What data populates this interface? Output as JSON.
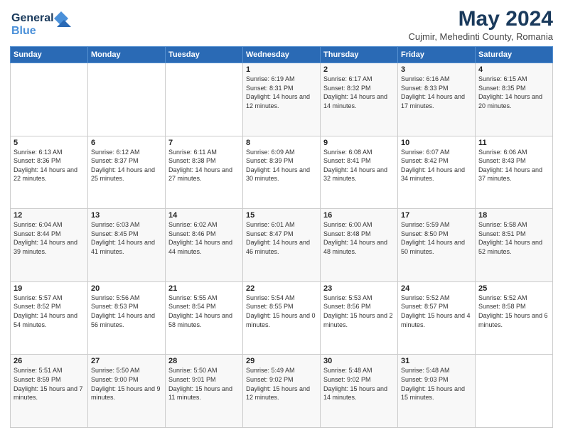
{
  "logo": {
    "line1": "General",
    "line2": "Blue"
  },
  "title": "May 2024",
  "subtitle": "Cujmir, Mehedinti County, Romania",
  "weekdays": [
    "Sunday",
    "Monday",
    "Tuesday",
    "Wednesday",
    "Thursday",
    "Friday",
    "Saturday"
  ],
  "weeks": [
    [
      {
        "day": "",
        "sunrise": "",
        "sunset": "",
        "daylight": ""
      },
      {
        "day": "",
        "sunrise": "",
        "sunset": "",
        "daylight": ""
      },
      {
        "day": "",
        "sunrise": "",
        "sunset": "",
        "daylight": ""
      },
      {
        "day": "1",
        "sunrise": "Sunrise: 6:19 AM",
        "sunset": "Sunset: 8:31 PM",
        "daylight": "Daylight: 14 hours and 12 minutes."
      },
      {
        "day": "2",
        "sunrise": "Sunrise: 6:17 AM",
        "sunset": "Sunset: 8:32 PM",
        "daylight": "Daylight: 14 hours and 14 minutes."
      },
      {
        "day": "3",
        "sunrise": "Sunrise: 6:16 AM",
        "sunset": "Sunset: 8:33 PM",
        "daylight": "Daylight: 14 hours and 17 minutes."
      },
      {
        "day": "4",
        "sunrise": "Sunrise: 6:15 AM",
        "sunset": "Sunset: 8:35 PM",
        "daylight": "Daylight: 14 hours and 20 minutes."
      }
    ],
    [
      {
        "day": "5",
        "sunrise": "Sunrise: 6:13 AM",
        "sunset": "Sunset: 8:36 PM",
        "daylight": "Daylight: 14 hours and 22 minutes."
      },
      {
        "day": "6",
        "sunrise": "Sunrise: 6:12 AM",
        "sunset": "Sunset: 8:37 PM",
        "daylight": "Daylight: 14 hours and 25 minutes."
      },
      {
        "day": "7",
        "sunrise": "Sunrise: 6:11 AM",
        "sunset": "Sunset: 8:38 PM",
        "daylight": "Daylight: 14 hours and 27 minutes."
      },
      {
        "day": "8",
        "sunrise": "Sunrise: 6:09 AM",
        "sunset": "Sunset: 8:39 PM",
        "daylight": "Daylight: 14 hours and 30 minutes."
      },
      {
        "day": "9",
        "sunrise": "Sunrise: 6:08 AM",
        "sunset": "Sunset: 8:41 PM",
        "daylight": "Daylight: 14 hours and 32 minutes."
      },
      {
        "day": "10",
        "sunrise": "Sunrise: 6:07 AM",
        "sunset": "Sunset: 8:42 PM",
        "daylight": "Daylight: 14 hours and 34 minutes."
      },
      {
        "day": "11",
        "sunrise": "Sunrise: 6:06 AM",
        "sunset": "Sunset: 8:43 PM",
        "daylight": "Daylight: 14 hours and 37 minutes."
      }
    ],
    [
      {
        "day": "12",
        "sunrise": "Sunrise: 6:04 AM",
        "sunset": "Sunset: 8:44 PM",
        "daylight": "Daylight: 14 hours and 39 minutes."
      },
      {
        "day": "13",
        "sunrise": "Sunrise: 6:03 AM",
        "sunset": "Sunset: 8:45 PM",
        "daylight": "Daylight: 14 hours and 41 minutes."
      },
      {
        "day": "14",
        "sunrise": "Sunrise: 6:02 AM",
        "sunset": "Sunset: 8:46 PM",
        "daylight": "Daylight: 14 hours and 44 minutes."
      },
      {
        "day": "15",
        "sunrise": "Sunrise: 6:01 AM",
        "sunset": "Sunset: 8:47 PM",
        "daylight": "Daylight: 14 hours and 46 minutes."
      },
      {
        "day": "16",
        "sunrise": "Sunrise: 6:00 AM",
        "sunset": "Sunset: 8:48 PM",
        "daylight": "Daylight: 14 hours and 48 minutes."
      },
      {
        "day": "17",
        "sunrise": "Sunrise: 5:59 AM",
        "sunset": "Sunset: 8:50 PM",
        "daylight": "Daylight: 14 hours and 50 minutes."
      },
      {
        "day": "18",
        "sunrise": "Sunrise: 5:58 AM",
        "sunset": "Sunset: 8:51 PM",
        "daylight": "Daylight: 14 hours and 52 minutes."
      }
    ],
    [
      {
        "day": "19",
        "sunrise": "Sunrise: 5:57 AM",
        "sunset": "Sunset: 8:52 PM",
        "daylight": "Daylight: 14 hours and 54 minutes."
      },
      {
        "day": "20",
        "sunrise": "Sunrise: 5:56 AM",
        "sunset": "Sunset: 8:53 PM",
        "daylight": "Daylight: 14 hours and 56 minutes."
      },
      {
        "day": "21",
        "sunrise": "Sunrise: 5:55 AM",
        "sunset": "Sunset: 8:54 PM",
        "daylight": "Daylight: 14 hours and 58 minutes."
      },
      {
        "day": "22",
        "sunrise": "Sunrise: 5:54 AM",
        "sunset": "Sunset: 8:55 PM",
        "daylight": "Daylight: 15 hours and 0 minutes."
      },
      {
        "day": "23",
        "sunrise": "Sunrise: 5:53 AM",
        "sunset": "Sunset: 8:56 PM",
        "daylight": "Daylight: 15 hours and 2 minutes."
      },
      {
        "day": "24",
        "sunrise": "Sunrise: 5:52 AM",
        "sunset": "Sunset: 8:57 PM",
        "daylight": "Daylight: 15 hours and 4 minutes."
      },
      {
        "day": "25",
        "sunrise": "Sunrise: 5:52 AM",
        "sunset": "Sunset: 8:58 PM",
        "daylight": "Daylight: 15 hours and 6 minutes."
      }
    ],
    [
      {
        "day": "26",
        "sunrise": "Sunrise: 5:51 AM",
        "sunset": "Sunset: 8:59 PM",
        "daylight": "Daylight: 15 hours and 7 minutes."
      },
      {
        "day": "27",
        "sunrise": "Sunrise: 5:50 AM",
        "sunset": "Sunset: 9:00 PM",
        "daylight": "Daylight: 15 hours and 9 minutes."
      },
      {
        "day": "28",
        "sunrise": "Sunrise: 5:50 AM",
        "sunset": "Sunset: 9:01 PM",
        "daylight": "Daylight: 15 hours and 11 minutes."
      },
      {
        "day": "29",
        "sunrise": "Sunrise: 5:49 AM",
        "sunset": "Sunset: 9:02 PM",
        "daylight": "Daylight: 15 hours and 12 minutes."
      },
      {
        "day": "30",
        "sunrise": "Sunrise: 5:48 AM",
        "sunset": "Sunset: 9:02 PM",
        "daylight": "Daylight: 15 hours and 14 minutes."
      },
      {
        "day": "31",
        "sunrise": "Sunrise: 5:48 AM",
        "sunset": "Sunset: 9:03 PM",
        "daylight": "Daylight: 15 hours and 15 minutes."
      },
      {
        "day": "",
        "sunrise": "",
        "sunset": "",
        "daylight": ""
      }
    ]
  ]
}
